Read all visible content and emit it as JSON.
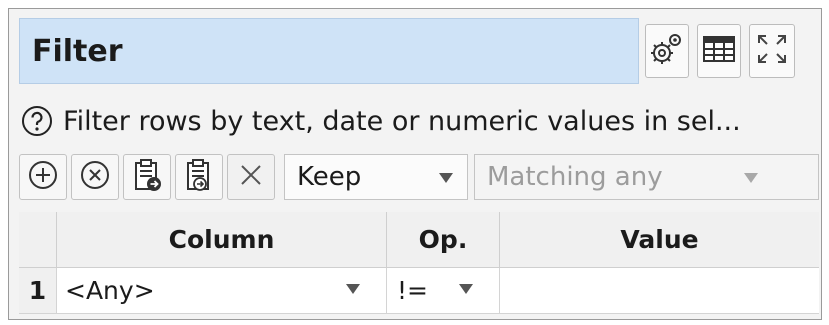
{
  "panel": {
    "title": "Filter",
    "help_text": "Filter rows by text, date or numeric values in sel...",
    "toolbar_icons": [
      "settings-gear-icon",
      "table-view-icon",
      "maximize-icon"
    ]
  },
  "toolbar": {
    "icons": [
      "add-circle-icon",
      "remove-circle-icon",
      "paste-icon",
      "paste-append-icon",
      "clear-x-icon"
    ],
    "mode_select": {
      "value": "Keep"
    },
    "match_select": {
      "value": "Matching any"
    }
  },
  "table": {
    "headers": [
      "",
      "Column",
      "Op.",
      "Value"
    ],
    "rows": [
      {
        "num": "1",
        "column": "<Any>",
        "op": "!=",
        "value": ""
      }
    ]
  },
  "colors": {
    "title_bg": "#cfe3f7",
    "panel_bg": "#f3f3f3",
    "header_bg": "#f0f0f0"
  }
}
